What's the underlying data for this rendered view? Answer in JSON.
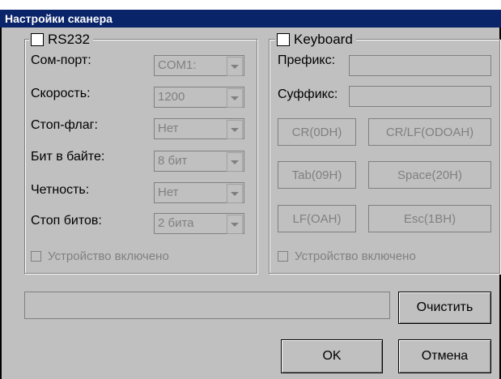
{
  "window": {
    "title": "Настройки сканера"
  },
  "rs232": {
    "title": "RS232",
    "checked": false,
    "fields": [
      {
        "label": "Сом-порт:",
        "value": "COM1:"
      },
      {
        "label": "Скорость:",
        "value": "1200"
      },
      {
        "label": "Стоп-флаг:",
        "value": "Нет"
      },
      {
        "label": "Бит в байте:",
        "value": "8 бит"
      },
      {
        "label": "Четность:",
        "value": "Нет"
      },
      {
        "label": "Стоп битов:",
        "value": "2 бита"
      }
    ],
    "device_enabled": "Устройство включено"
  },
  "keyboard": {
    "title": "Keyboard",
    "checked": false,
    "prefix_label": "Префикс:",
    "prefix_value": "",
    "suffix_label": "Суффикс:",
    "suffix_value": "",
    "buttons": [
      "CR(0DH)",
      "CR/LF(ODOAH)",
      "Tab(09H)",
      "Space(20H)",
      "LF(OAH)",
      "Esc(1BH)"
    ],
    "device_enabled": "Устройство включено"
  },
  "footer": {
    "status_text": "",
    "clear_label": "Очистить",
    "ok_label": "OK",
    "cancel_label": "Отмена"
  },
  "colors": {
    "titlebar": "#0a246a",
    "dialog_bg": "#c0c0c0",
    "disabled_text": "#808080"
  }
}
